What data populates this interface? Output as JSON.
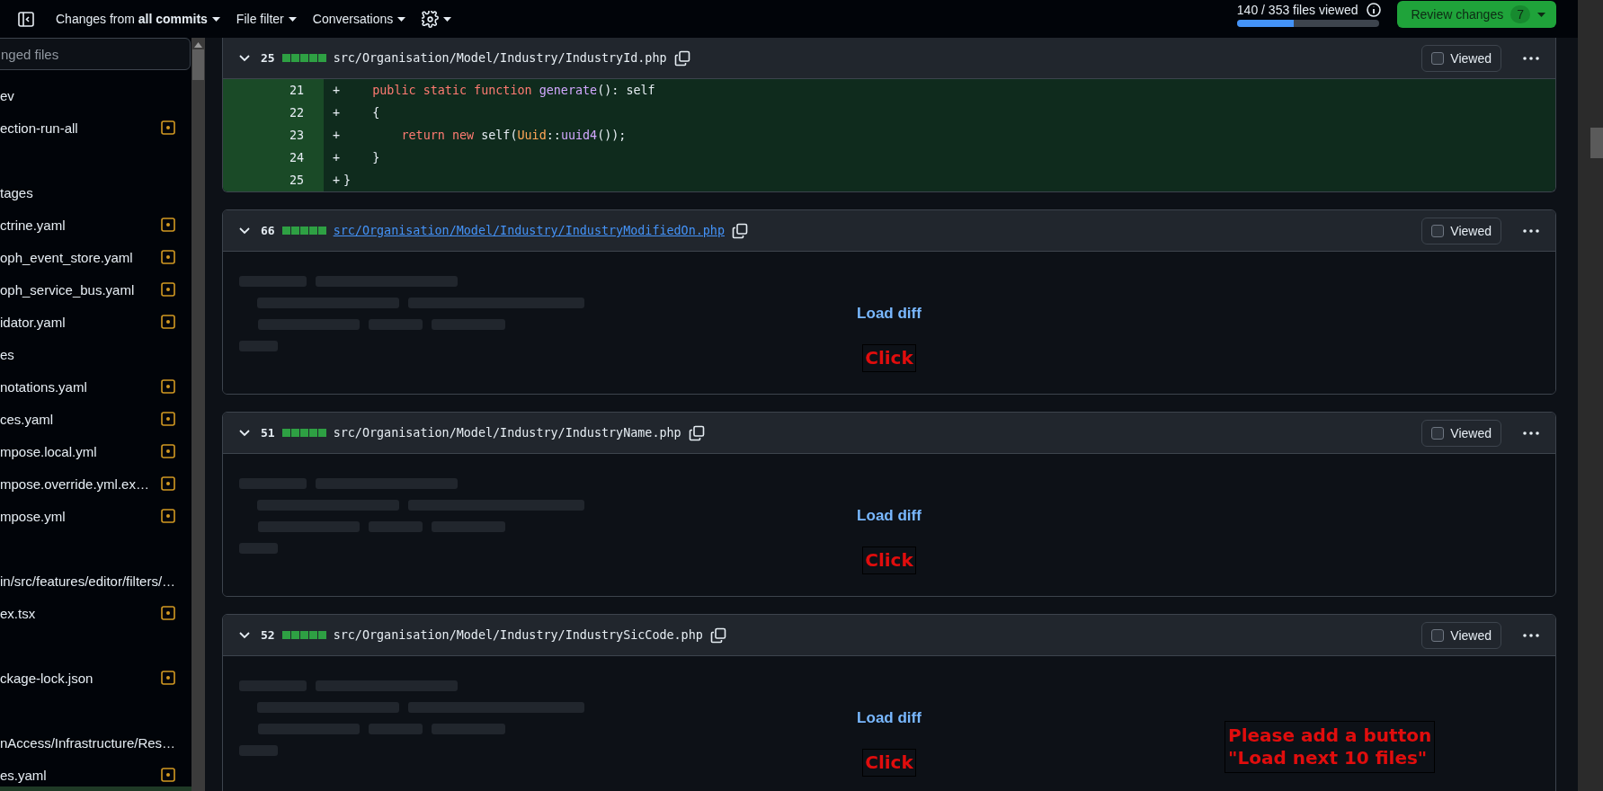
{
  "topbar": {
    "menus": [
      {
        "kind": "text",
        "label": "Changes from **all commits**"
      },
      {
        "kind": "text",
        "label": "File filter"
      },
      {
        "kind": "text",
        "label": "Conversations"
      },
      {
        "kind": "settings"
      }
    ],
    "progress": {
      "label": "140 / 353 files viewed",
      "level": 0.397
    },
    "review": {
      "label": "Review changes",
      "count": "7"
    }
  },
  "sidebar": {
    "search": {
      "placeholder": "nged files"
    },
    "items": [
      {
        "kind": "dir",
        "label": "ev"
      },
      {
        "kind": "file",
        "label": "ection-run-all"
      },
      {
        "kind": "spacer"
      },
      {
        "kind": "dir",
        "label": "tages"
      },
      {
        "kind": "file",
        "label": "ctrine.yaml"
      },
      {
        "kind": "file",
        "label": "oph_event_store.yaml"
      },
      {
        "kind": "file",
        "label": "oph_service_bus.yaml"
      },
      {
        "kind": "file",
        "label": "idator.yaml"
      },
      {
        "kind": "dir",
        "label": "es"
      },
      {
        "kind": "file",
        "label": "notations.yaml"
      },
      {
        "kind": "file",
        "label": "ces.yaml"
      },
      {
        "kind": "file",
        "label": "mpose.local.yml"
      },
      {
        "kind": "file",
        "label": "mpose.override.yml.ex…"
      },
      {
        "kind": "file",
        "label": "mpose.yml"
      },
      {
        "kind": "spacer"
      },
      {
        "kind": "dir",
        "label": "in/src/features/editor/filters/…"
      },
      {
        "kind": "file",
        "label": "ex.tsx"
      },
      {
        "kind": "spacer"
      },
      {
        "kind": "file",
        "label": "ckage-lock.json"
      },
      {
        "kind": "spacer"
      },
      {
        "kind": "dir",
        "label": "nAccess/Infrastructure/Res…"
      },
      {
        "kind": "file",
        "label": "es.yaml"
      }
    ]
  },
  "files": [
    {
      "kind": "code",
      "count": "25",
      "path": "src/Organisation/Model/Industry/IndustryId.php",
      "hovered": false,
      "viewed": false,
      "viewed_label": "Viewed",
      "lines": [
        {
          "number": "21",
          "sign": "+",
          "tokens": [
            {
              "kind": "keyword",
              "text": "    public static function "
            },
            {
              "kind": "function",
              "text": "generate"
            },
            {
              "kind": "plain",
              "text": "(): self"
            }
          ]
        },
        {
          "number": "22",
          "sign": "+",
          "tokens": [
            {
              "kind": "plain",
              "text": "    {"
            }
          ]
        },
        {
          "number": "23",
          "sign": "+",
          "tokens": [
            {
              "kind": "keyword",
              "text": "        return new"
            },
            {
              "kind": "plain",
              "text": " self("
            },
            {
              "kind": "class",
              "text": "Uuid"
            },
            {
              "kind": "plain",
              "text": "::"
            },
            {
              "kind": "function",
              "text": "uuid4"
            },
            {
              "kind": "plain",
              "text": "());"
            }
          ]
        },
        {
          "number": "24",
          "sign": "+",
          "tokens": [
            {
              "kind": "plain",
              "text": "    }"
            }
          ]
        },
        {
          "number": "25",
          "sign": "+",
          "tokens": [
            {
              "kind": "plain",
              "text": "}"
            }
          ]
        }
      ]
    },
    {
      "kind": "pending",
      "count": "66",
      "path": "src/Organisation/Model/Industry/IndustryModifiedOn.php",
      "hovered": true,
      "viewed": false,
      "viewed_label": "Viewed",
      "load_label": "Load diff",
      "annotation": "Click"
    },
    {
      "kind": "pending",
      "count": "51",
      "path": "src/Organisation/Model/Industry/IndustryName.php",
      "hovered": false,
      "viewed": false,
      "viewed_label": "Viewed",
      "load_label": "Load diff",
      "annotation": "Click"
    },
    {
      "kind": "pending",
      "count": "52",
      "path": "src/Organisation/Model/Industry/IndustrySicCode.php",
      "hovered": false,
      "viewed": false,
      "viewed_label": "Viewed",
      "load_label": "Load diff",
      "annotation": "Click",
      "note_lines": [
        "Please add a button",
        "\"Load next 10 files\""
      ]
    }
  ]
}
